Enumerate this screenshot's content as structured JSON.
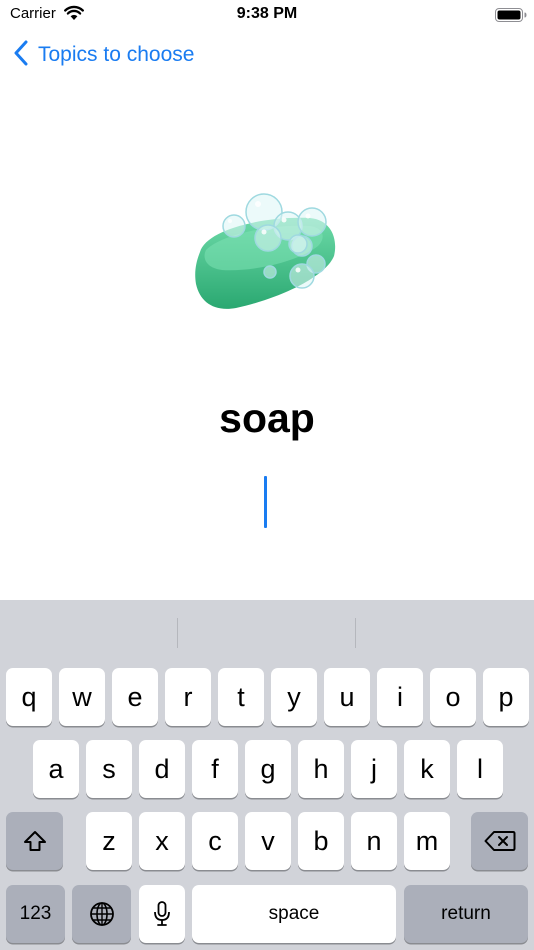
{
  "status_bar": {
    "carrier": "Carrier",
    "time": "9:38 PM"
  },
  "nav": {
    "back_label": "Topics to choose"
  },
  "main": {
    "word": "soap",
    "image_icon": "soap-icon"
  },
  "keyboard": {
    "row1": [
      "q",
      "w",
      "e",
      "r",
      "t",
      "y",
      "u",
      "i",
      "o",
      "p"
    ],
    "row2": [
      "a",
      "s",
      "d",
      "f",
      "g",
      "h",
      "j",
      "k",
      "l"
    ],
    "row3": [
      "z",
      "x",
      "c",
      "v",
      "b",
      "n",
      "m"
    ],
    "numbers_label": "123",
    "space_label": "space",
    "return_label": "return"
  },
  "colors": {
    "accent": "#1a7cf1",
    "keyboard_bg": "#d1d3d9",
    "soap": "#3dbb86"
  }
}
